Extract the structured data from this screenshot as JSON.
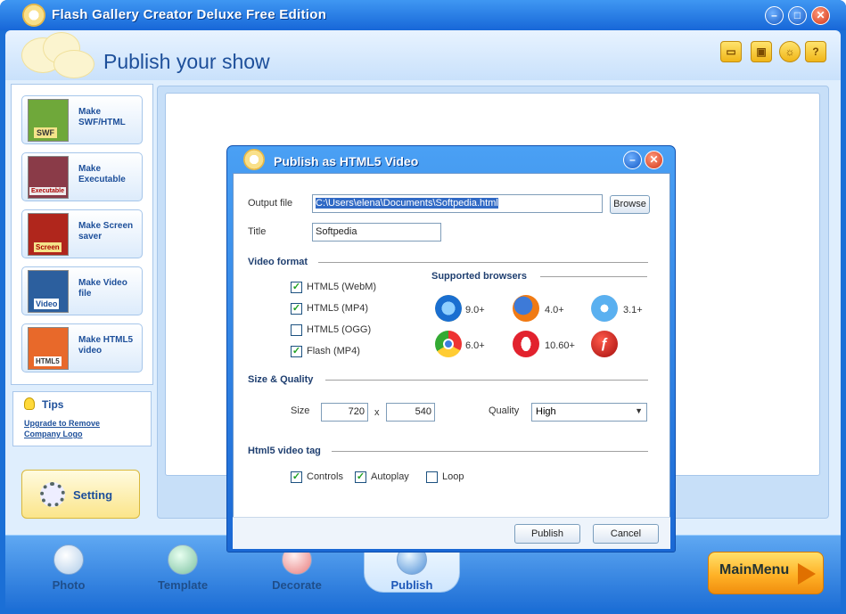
{
  "window": {
    "title": "Flash Gallery Creator Deluxe Free Edition",
    "minimize": "–",
    "restore": "□",
    "close": "✕"
  },
  "header": {
    "title": "Publish your show",
    "icons": [
      "folder-icon",
      "save-icon",
      "lightbulb-icon",
      "help-icon"
    ]
  },
  "sidebar": {
    "items": [
      {
        "label": "Make SWF/HTML",
        "badge": "SWF",
        "color": "#6fa83a"
      },
      {
        "label": "Make Executable",
        "badge": "Executable",
        "color": "#8a3b48"
      },
      {
        "label": "Make Screen saver",
        "badge": "Screen",
        "color": "#b0261c"
      },
      {
        "label": "Make Video file",
        "badge": "Video",
        "color": "#2c5f9e"
      },
      {
        "label": "Make HTML5 video",
        "badge": "HTML5",
        "color": "#e8692a"
      }
    ]
  },
  "tips": {
    "title": "Tips",
    "link": "Upgrade to Remove Company Logo"
  },
  "setting": {
    "label": "Setting"
  },
  "tabs": [
    {
      "label": "Photo"
    },
    {
      "label": "Template"
    },
    {
      "label": "Decorate"
    },
    {
      "label": "Publish"
    }
  ],
  "mainmenu": {
    "label": "MainMenu"
  },
  "dialog": {
    "title": "Publish as HTML5 Video",
    "output_file_label": "Output file",
    "output_file_value": "C:\\Users\\elena\\Documents\\Softpedia.html",
    "browse_label": "Browse",
    "title_label": "Title",
    "title_value": "Softpedia",
    "video_format_heading": "Video format",
    "formats": [
      {
        "label": "HTML5 (WebM)",
        "checked": true
      },
      {
        "label": "HTML5 (MP4)",
        "checked": true
      },
      {
        "label": "HTML5 (OGG)",
        "checked": false
      },
      {
        "label": "Flash (MP4)",
        "checked": true
      }
    ],
    "supported_browsers_heading": "Supported browsers",
    "browsers": [
      {
        "icon": "internet-explorer-icon",
        "version": "9.0+"
      },
      {
        "icon": "firefox-icon",
        "version": "4.0+"
      },
      {
        "icon": "safari-icon",
        "version": "3.1+"
      },
      {
        "icon": "chrome-icon",
        "version": "6.0+"
      },
      {
        "icon": "opera-icon",
        "version": "10.60+"
      },
      {
        "icon": "flash-player-icon",
        "version": ""
      }
    ],
    "size_quality_heading": "Size & Quality",
    "size_label": "Size",
    "width": "720",
    "x_label": "x",
    "height": "540",
    "quality_label": "Quality",
    "quality_value": "High",
    "html5_tag_heading": "Html5 video tag",
    "tag_options": [
      {
        "label": "Controls",
        "checked": true
      },
      {
        "label": "Autoplay",
        "checked": true
      },
      {
        "label": "Loop",
        "checked": false
      }
    ],
    "publish_label": "Publish",
    "cancel_label": "Cancel"
  }
}
